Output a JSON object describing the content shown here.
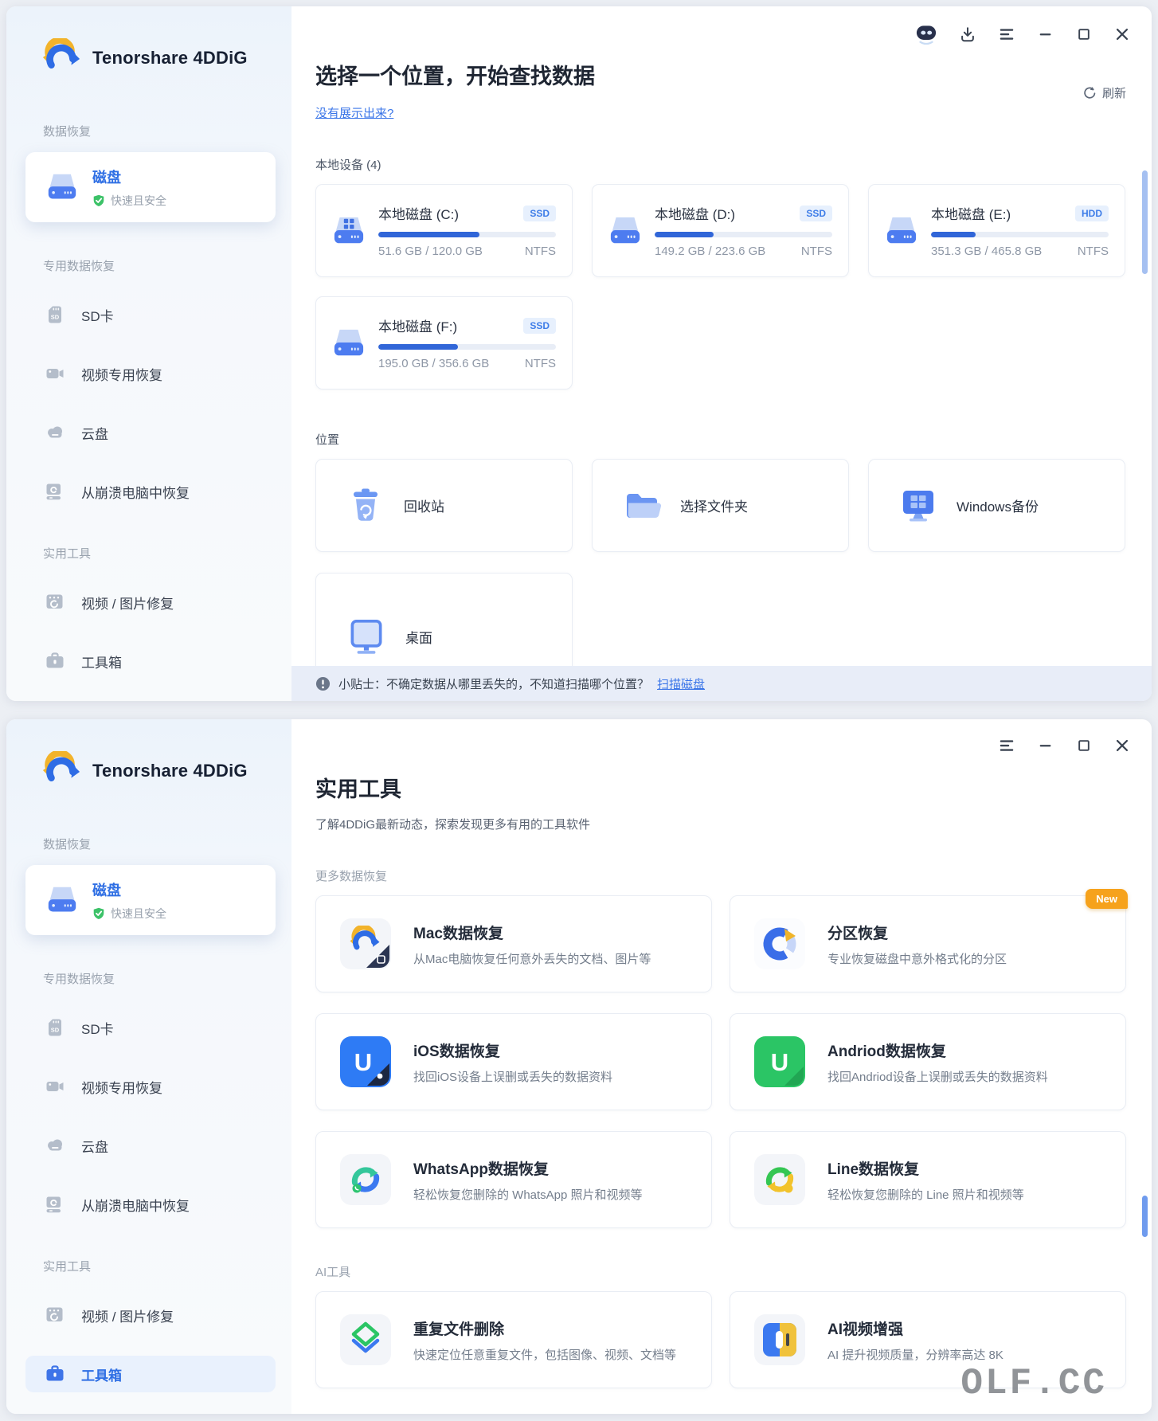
{
  "brand": {
    "name": "Tenorshare 4DDiG"
  },
  "sidebar": {
    "section1_label": "数据恢复",
    "disk_item": {
      "label": "磁盘",
      "sub": "快速且安全"
    },
    "section2_label": "专用数据恢复",
    "items2": [
      {
        "label": "SD卡",
        "icon": "sd-card-icon"
      },
      {
        "label": "视频专用恢复",
        "icon": "video-camera-icon"
      },
      {
        "label": "云盘",
        "icon": "cloud-icon"
      },
      {
        "label": "从崩溃电脑中恢复",
        "icon": "crashed-pc-icon"
      }
    ],
    "section3_label": "实用工具",
    "items3": [
      {
        "label": "视频 / 图片修复",
        "icon": "media-repair-icon"
      },
      {
        "label": "工具箱",
        "icon": "toolbox-icon"
      }
    ]
  },
  "window1": {
    "title": "选择一个位置，开始查找数据",
    "not_shown_link": "没有展示出来?",
    "refresh_label": "刷新",
    "local_devices_label": "本地设备 (4)",
    "disks": [
      {
        "name": "本地磁盘 (C:)",
        "badge": "SSD",
        "usage": "51.6 GB / 120.0 GB",
        "fs": "NTFS",
        "percent": 57
      },
      {
        "name": "本地磁盘 (D:)",
        "badge": "SSD",
        "usage": "149.2 GB / 223.6 GB",
        "fs": "NTFS",
        "percent": 33
      },
      {
        "name": "本地磁盘 (E:)",
        "badge": "HDD",
        "usage": "351.3 GB / 465.8 GB",
        "fs": "NTFS",
        "percent": 25
      },
      {
        "name": "本地磁盘 (F:)",
        "badge": "SSD",
        "usage": "195.0 GB / 356.6 GB",
        "fs": "NTFS",
        "percent": 45
      }
    ],
    "locations_label": "位置",
    "locations": [
      {
        "label": "回收站",
        "icon": "recycle-bin-icon"
      },
      {
        "label": "选择文件夹",
        "icon": "folder-icon"
      },
      {
        "label": "Windows备份",
        "icon": "windows-backup-icon"
      },
      {
        "label": "桌面",
        "icon": "desktop-icon"
      }
    ],
    "tip": {
      "text": "小贴士：不确定数据从哪里丢失的，不知道扫描哪个位置？",
      "link": "扫描磁盘"
    }
  },
  "window2": {
    "title": "实用工具",
    "subtitle": "了解4DDiG最新动态，探索发现更多有用的工具软件",
    "more_recovery_label": "更多数据恢复",
    "ai_tools_label": "AI工具",
    "new_badge": "New",
    "tools": [
      {
        "title": "Mac数据恢复",
        "desc": "从Mac电脑恢复任何意外丢失的文档、图片等",
        "icon": "mac-recovery-icon"
      },
      {
        "title": "分区恢复",
        "desc": "专业恢复磁盘中意外格式化的分区",
        "icon": "partition-recovery-icon"
      },
      {
        "title": "iOS数据恢复",
        "desc": "找回iOS设备上误删或丢失的数据资料",
        "icon": "ios-recovery-icon"
      },
      {
        "title": "Andriod数据恢复",
        "desc": "找回Andriod设备上误删或丢失的数据资料",
        "icon": "android-recovery-icon"
      },
      {
        "title": "WhatsApp数据恢复",
        "desc": "轻松恢复您删除的 WhatsApp 照片和视频等",
        "icon": "whatsapp-recovery-icon"
      },
      {
        "title": "Line数据恢复",
        "desc": "轻松恢复您删除的 Line 照片和视频等",
        "icon": "line-recovery-icon"
      },
      {
        "title": "重复文件删除",
        "desc": "快速定位任意重复文件，包括图像、视频、文档等",
        "icon": "duplicate-file-icon"
      },
      {
        "title": "AI视频增强",
        "desc": "AI 提升视频质量，分辨率高达 8K",
        "icon": "ai-video-icon"
      }
    ]
  },
  "watermark": "OLF.CC",
  "colors": {
    "accent": "#2f6fe4",
    "badge_blue": "#3e7de8",
    "new_badge_orange": "#f6a21c",
    "success_green": "#3cc268",
    "progress_fill": "#3166d8"
  }
}
